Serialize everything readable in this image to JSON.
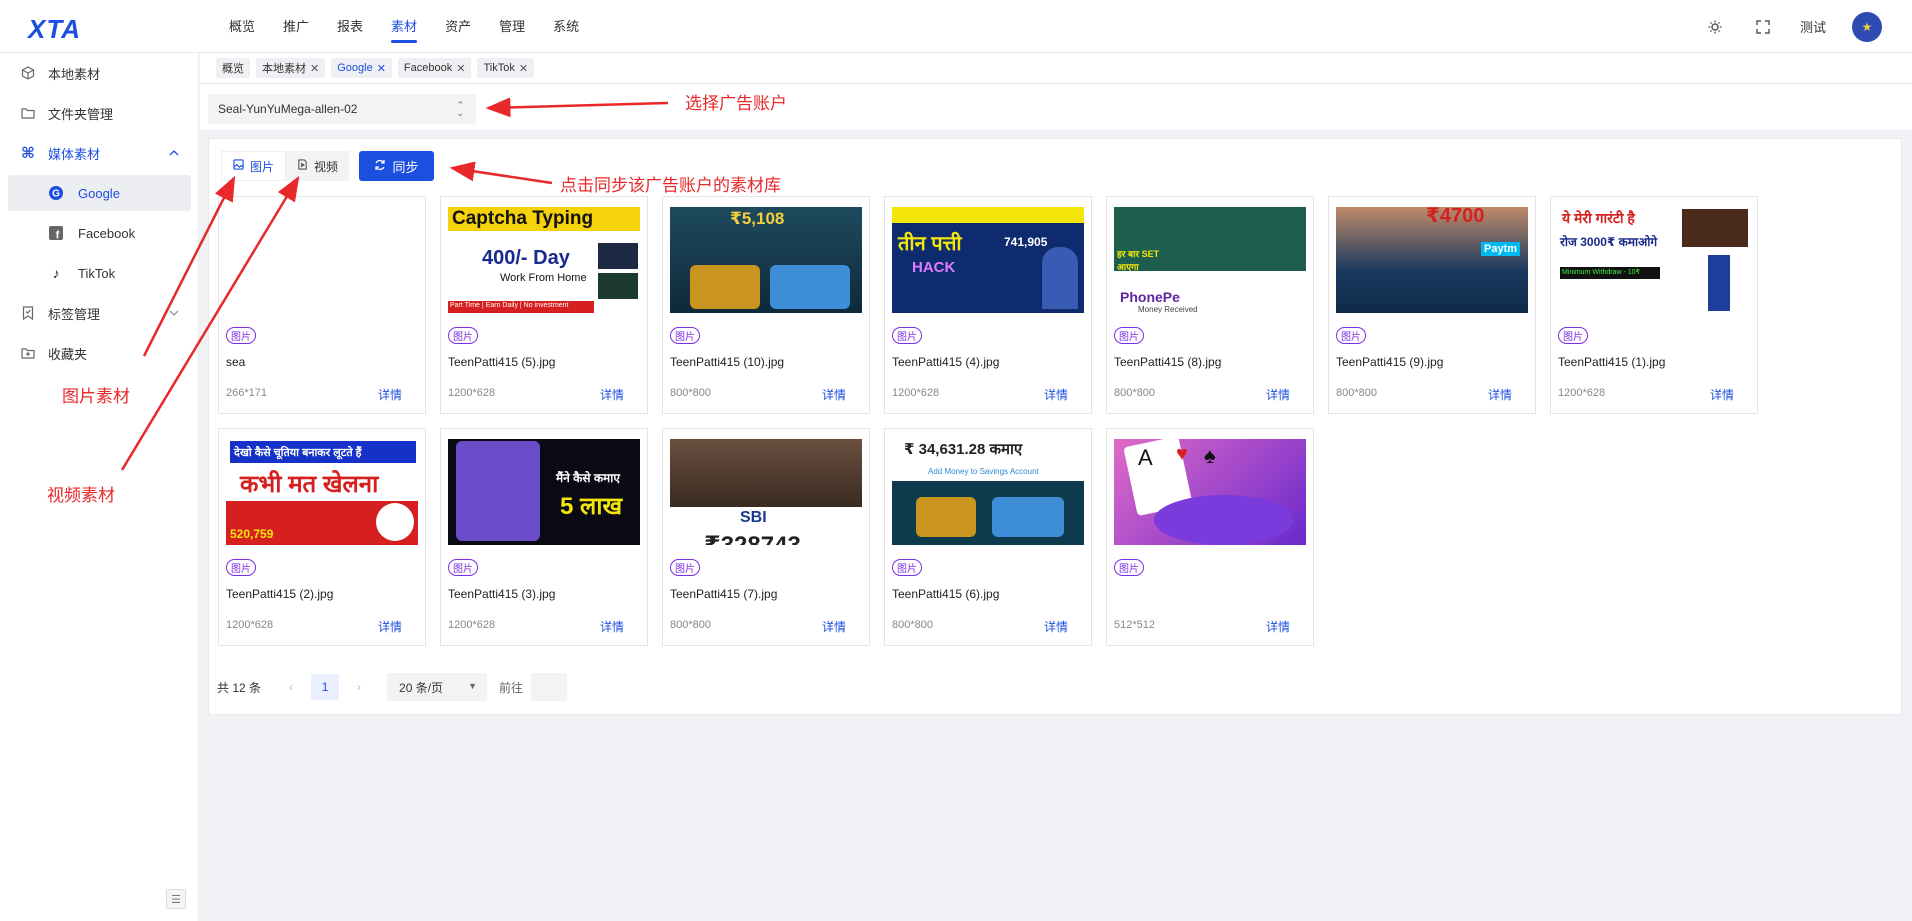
{
  "header": {
    "logo": "XTA",
    "nav": [
      "概览",
      "推广",
      "报表",
      "素材",
      "资产",
      "管理",
      "系统"
    ],
    "active_nav": "素材",
    "username": "测试",
    "theme_icon": "sun-icon",
    "fullscreen_icon": "fullscreen-icon"
  },
  "sidebar": {
    "items": [
      {
        "label": "本地素材",
        "icon": "cube-icon"
      },
      {
        "label": "文件夹管理",
        "icon": "folder-icon"
      },
      {
        "label": "媒体素材",
        "icon": "command-icon"
      },
      {
        "label": "Google",
        "icon": "google-icon"
      },
      {
        "label": "Facebook",
        "icon": "facebook-icon"
      },
      {
        "label": "TikTok",
        "icon": "tiktok-icon"
      },
      {
        "label": "标签管理",
        "icon": "bookmark-icon"
      },
      {
        "label": "收藏夹",
        "icon": "favorite-folder-icon"
      }
    ]
  },
  "tabs": [
    "概览",
    "本地素材",
    "Google",
    "Facebook",
    "TikTok"
  ],
  "active_tab": "Google",
  "account": {
    "selected": "Seal-YunYuMega-allen-02"
  },
  "media_tabs": {
    "image": "图片",
    "video": "视频",
    "sync": "同步"
  },
  "cards": [
    {
      "name": "sea",
      "size": "266*171",
      "badge": "图片",
      "detail": "详情"
    },
    {
      "name": "TeenPatti415 (5).jpg",
      "size": "1200*628",
      "badge": "图片",
      "detail": "详情",
      "thumb_text": "Captcha Typing",
      "thumb_sub": "400/- Day",
      "thumb_sub2": "Work From Home",
      "thumb_foot": "Part Time | Earn Daily | No investment"
    },
    {
      "name": "TeenPatti415 (10).jpg",
      "size": "800*800",
      "badge": "图片",
      "detail": "详情",
      "thumb_text": "₹5,108"
    },
    {
      "name": "TeenPatti415 (4).jpg",
      "size": "1200*628",
      "badge": "图片",
      "detail": "详情",
      "thumb_text": "तीन पत्ती",
      "thumb_sub": "741,905",
      "thumb_sub2": "HACK"
    },
    {
      "name": "TeenPatti415 (8).jpg",
      "size": "800*800",
      "badge": "图片",
      "detail": "详情",
      "thumb_text": "PhonePe",
      "thumb_sub": "हर बार SET आएगा",
      "thumb_sub2": "Money Received"
    },
    {
      "name": "TeenPatti415 (9).jpg",
      "size": "800*800",
      "badge": "图片",
      "detail": "详情",
      "thumb_text": "₹4700",
      "thumb_sub": "Paytm"
    },
    {
      "name": "TeenPatti415 (1).jpg",
      "size": "1200*628",
      "badge": "图片",
      "detail": "详情",
      "thumb_text": "ये मेरी गारंटी है",
      "thumb_sub": "रोज 3000₹ कमाओगे",
      "thumb_sub2": "Minimum Withdraw - 10₹"
    },
    {
      "name": "TeenPatti415 (2).jpg",
      "size": "1200*628",
      "badge": "图片",
      "detail": "详情",
      "thumb_text": "देखो कैसे चूतिया बनाकर लूटते हैं",
      "thumb_sub": "कभी मत खेलना",
      "thumb_sub2": "520,759"
    },
    {
      "name": "TeenPatti415 (3).jpg",
      "size": "1200*628",
      "badge": "图片",
      "detail": "详情",
      "thumb_text": "मैंने कैसे कमाए",
      "thumb_sub": "5 लाख"
    },
    {
      "name": "TeenPatti415 (7).jpg",
      "size": "800*800",
      "badge": "图片",
      "detail": "详情",
      "thumb_text": "SBI",
      "thumb_sub": "₹328743"
    },
    {
      "name": "TeenPatti415 (6).jpg",
      "size": "800*800",
      "badge": "图片",
      "detail": "详情",
      "thumb_text": "₹ 34,631.28 कमाए",
      "thumb_sub": "Add Money to Savings Account"
    },
    {
      "name": "",
      "size": "512*512",
      "badge": "图片",
      "detail": "详情"
    }
  ],
  "pagination": {
    "total": "共 12 条",
    "page": "1",
    "page_size": "20 条/页",
    "goto": "前往"
  },
  "annotations": {
    "select_account": "选择广告账户",
    "sync_hint": "点击同步该广告账户的素材库",
    "image_material": "图片素材",
    "video_material": "视频素材"
  },
  "colors": {
    "accent": "#1c4ee0",
    "annotation": "#e8282a",
    "badge": "#7b2ee6"
  }
}
